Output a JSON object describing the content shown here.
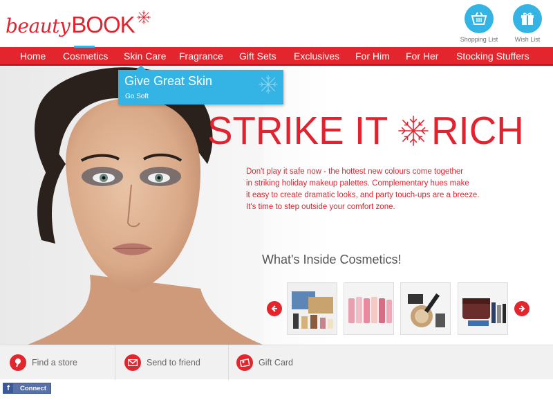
{
  "brand": {
    "logo_script": "beauty",
    "logo_caps": "BOOK",
    "accent_color": "#e3252d",
    "secondary_color": "#33b4e4"
  },
  "header": {
    "shopping_list_label": "Shopping List",
    "wish_list_label": "Wish List"
  },
  "nav": {
    "items": [
      {
        "label": "Home"
      },
      {
        "label": "Cosmetics"
      },
      {
        "label": "Skin Care"
      },
      {
        "label": "Fragrance"
      },
      {
        "label": "Gift Sets"
      },
      {
        "label": "Exclusives"
      },
      {
        "label": "For Him"
      },
      {
        "label": "For Her"
      },
      {
        "label": "Stocking Stuffers"
      }
    ],
    "active": "Cosmetics"
  },
  "dropdown": {
    "title": "Give Great Skin",
    "subtitle": "Go Soft"
  },
  "hero": {
    "headline_left": "STRIKE IT",
    "headline_right": "RICH",
    "description_lines": [
      "Don't play it safe now - the hottest new colours come together",
      "in striking holiday makeup palettes. Complementary hues make",
      "it easy to create dramatic looks, and party touch-ups are a breeze.",
      "It's time to step outside your comfort zone."
    ],
    "inside_title": "What's Inside Cosmetics!"
  },
  "carousel": {
    "prev_icon": "arrow-left-icon",
    "next_icon": "arrow-right-icon"
  },
  "bottom": {
    "find_store": "Find a store",
    "send_friend": "Send to friend",
    "gift_card": "Gift Card"
  },
  "facebook": {
    "label": "Connect"
  }
}
